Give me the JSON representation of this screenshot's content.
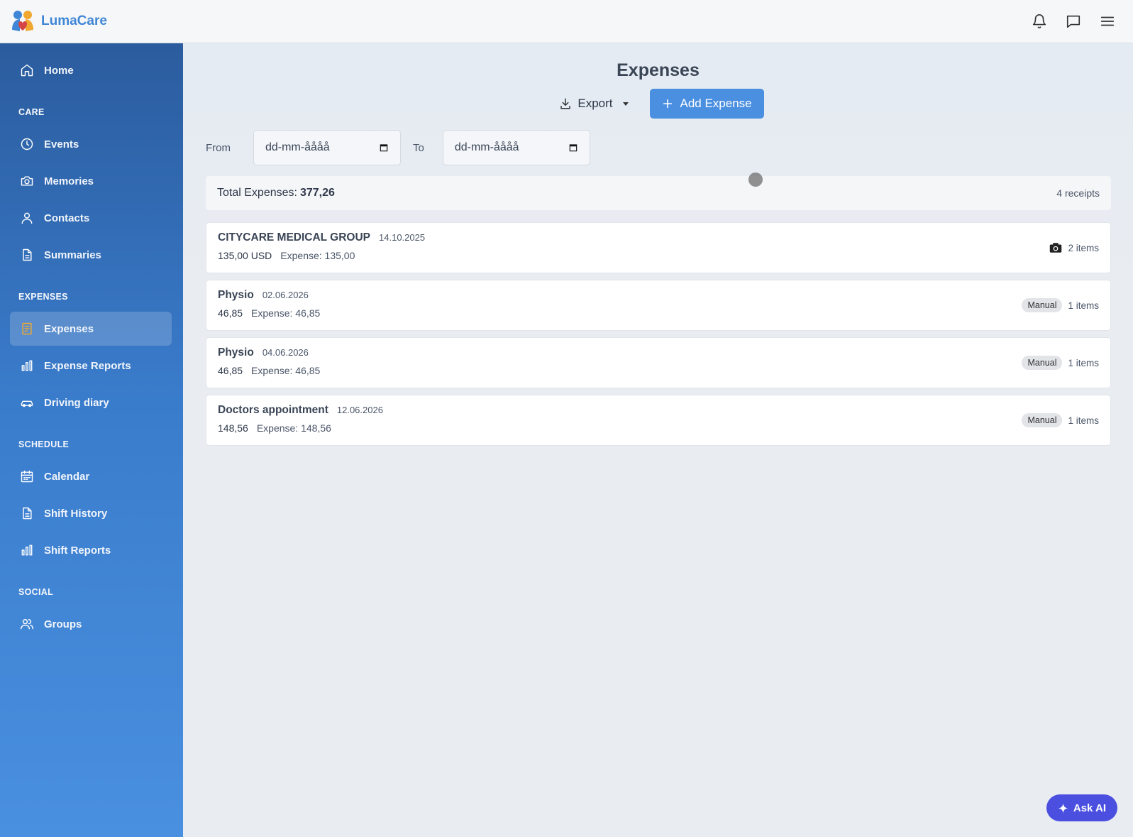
{
  "app": {
    "name": "LumaCare"
  },
  "sidebar": {
    "home": "Home",
    "sections": {
      "care": "CARE",
      "expenses": "EXPENSES",
      "schedule": "SCHEDULE",
      "social": "SOCIAL"
    },
    "care_items": [
      "Events",
      "Memories",
      "Contacts",
      "Summaries"
    ],
    "expense_items": [
      "Expenses",
      "Expense Reports",
      "Driving diary"
    ],
    "schedule_items": [
      "Calendar",
      "Shift History",
      "Shift Reports"
    ],
    "social_items": [
      "Groups"
    ],
    "active": "Expenses"
  },
  "page": {
    "title": "Expenses",
    "export_label": "Export",
    "add_label": "Add Expense"
  },
  "filters": {
    "from_label": "From",
    "to_label": "To",
    "from_value": "dd-mm-åååå",
    "to_value": "dd-mm-åååå"
  },
  "summary": {
    "total_label": "Total Expenses:",
    "total_value": "377,26",
    "receipts": "4 receipts"
  },
  "expenses": [
    {
      "name": "CITYCARE MEDICAL GROUP",
      "date": "14.10.2025",
      "amount": "135,00 USD",
      "expense": "Expense: 135,00",
      "source": "camera-icon",
      "items": "2 items"
    },
    {
      "name": "Physio",
      "date": "02.06.2026",
      "amount": "46,85",
      "expense": "Expense: 46,85",
      "source": "Manual",
      "items": "1 items"
    },
    {
      "name": "Physio",
      "date": "04.06.2026",
      "amount": "46,85",
      "expense": "Expense: 46,85",
      "source": "Manual",
      "items": "1 items"
    },
    {
      "name": "Doctors appointment",
      "date": "12.06.2026",
      "amount": "148,56",
      "expense": "Expense: 148,56",
      "source": "Manual",
      "items": "1 items"
    }
  ],
  "ask_ai": "Ask AI",
  "colors": {
    "brand": "#3f86d6",
    "primary_button": "#4a8fe0",
    "ask_ai": "#4b4fe0",
    "sidebar_top": "#2b5c9e",
    "sidebar_bottom": "#4a90e0",
    "active_icon": "#f0a830"
  }
}
